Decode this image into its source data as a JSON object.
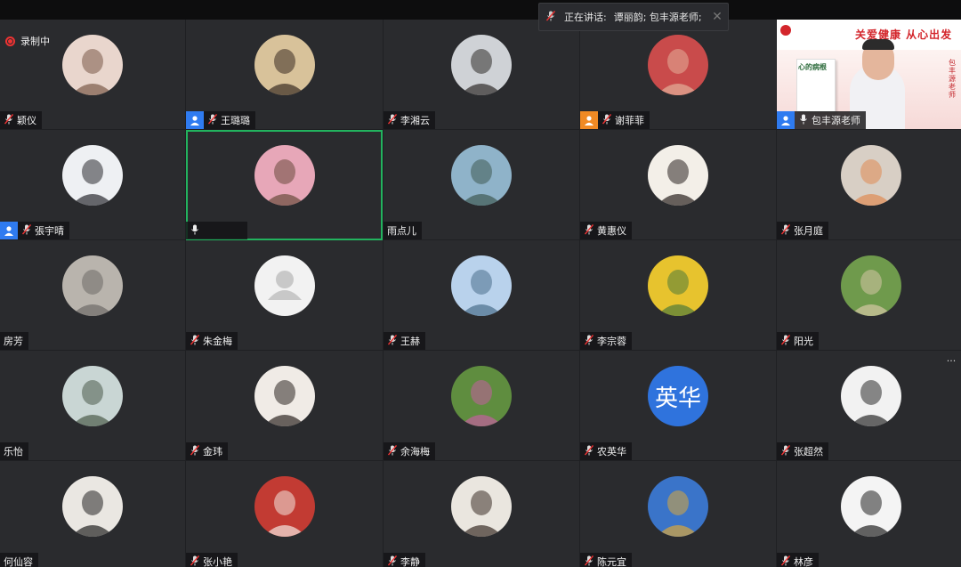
{
  "recording": {
    "label": "录制中"
  },
  "speaker_bar": {
    "label": "正在讲话:",
    "names": "谭丽韵; 包丰源老师;"
  },
  "colors": {
    "active_border": "#22b35e",
    "user_icon_blue": "#2f7bf0",
    "user_icon_orange": "#f08a24"
  },
  "video_tile": {
    "banner_text": "关爱健康 从心出发",
    "book_title": "心的病根",
    "side_text": "包丰源 老师"
  },
  "participants": [
    {
      "name": "颖仪",
      "mic": "muted",
      "avatar": "photo",
      "colors": [
        "#e9d6cd",
        "#7a5a48"
      ]
    },
    {
      "name": "王璐璐",
      "mic": "muted",
      "avatar": "photo",
      "badge": "blue",
      "colors": [
        "#d8c29a",
        "#3a2c22"
      ]
    },
    {
      "name": "李湘云",
      "mic": "muted",
      "avatar": "photo",
      "colors": [
        "#cfd2d6",
        "#2f2b2a"
      ]
    },
    {
      "name": "谢菲菲",
      "mic": "muted",
      "avatar": "photo",
      "badge": "orange",
      "colors": [
        "#c94b4b",
        "#e3b09a"
      ]
    },
    {
      "name": "包丰源老师",
      "mic": "on",
      "avatar": "video",
      "badge": "blue"
    },
    {
      "name": "張宇晴",
      "mic": "muted",
      "avatar": "photo",
      "badge": "blue",
      "colors": [
        "#eef0f3",
        "#2b2b30"
      ]
    },
    {
      "name": "",
      "mic": "on",
      "avatar": "photo",
      "active": true,
      "colors": [
        "#e7a7b8",
        "#6a4b3c"
      ]
    },
    {
      "name": "雨点儿",
      "mic": "none",
      "avatar": "photo",
      "colors": [
        "#8fb3c9",
        "#3f5a52"
      ]
    },
    {
      "name": "黄惠仪",
      "mic": "muted",
      "avatar": "photo",
      "colors": [
        "#f3efe8",
        "#2a2220"
      ]
    },
    {
      "name": "张月庭",
      "mic": "muted",
      "avatar": "photo",
      "colors": [
        "#d8cfc5",
        "#e08a52"
      ]
    },
    {
      "name": "房芳",
      "mic": "none",
      "avatar": "photo",
      "colors": [
        "#b9b4ad",
        "#6e6a66"
      ]
    },
    {
      "name": "朱金梅",
      "mic": "muted",
      "avatar": "default"
    },
    {
      "name": "王赫",
      "mic": "muted",
      "avatar": "photo",
      "colors": [
        "#b9d2ec",
        "#4a6d8c"
      ]
    },
    {
      "name": "李宗蓉",
      "mic": "muted",
      "avatar": "photo",
      "colors": [
        "#e7c32e",
        "#4f7a3a"
      ]
    },
    {
      "name": "阳光",
      "mic": "muted",
      "avatar": "photo",
      "colors": [
        "#6f9a4c",
        "#d6c7a5"
      ]
    },
    {
      "name": "乐怡",
      "mic": "none",
      "avatar": "photo",
      "colors": [
        "#c9d6d4",
        "#4b5b4a"
      ]
    },
    {
      "name": "金玮",
      "mic": "muted",
      "avatar": "photo",
      "colors": [
        "#f0ebe6",
        "#2e2622"
      ]
    },
    {
      "name": "余海梅",
      "mic": "muted",
      "avatar": "photo",
      "colors": [
        "#5f8d3f",
        "#c35fa0"
      ]
    },
    {
      "name": "农英华",
      "mic": "muted",
      "avatar": "text",
      "avatar_text": "英华"
    },
    {
      "name": "张超然",
      "mic": "muted",
      "avatar": "photo",
      "colors": [
        "#f2f2f2",
        "#2b2b2b"
      ]
    },
    {
      "name": "何仙容",
      "mic": "none",
      "avatar": "photo",
      "colors": [
        "#eae7e2",
        "#242424"
      ]
    },
    {
      "name": "张小艳",
      "mic": "muted",
      "avatar": "photo",
      "colors": [
        "#c23b33",
        "#f2e7df"
      ]
    },
    {
      "name": "李静",
      "mic": "muted",
      "avatar": "photo",
      "colors": [
        "#eae6df",
        "#3a2d26"
      ]
    },
    {
      "name": "陈元宜",
      "mic": "muted",
      "avatar": "photo",
      "colors": [
        "#3a74c9",
        "#d9a73a"
      ]
    },
    {
      "name": "林彦",
      "mic": "muted",
      "avatar": "photo",
      "colors": [
        "#f4f4f4",
        "#222222"
      ]
    }
  ]
}
